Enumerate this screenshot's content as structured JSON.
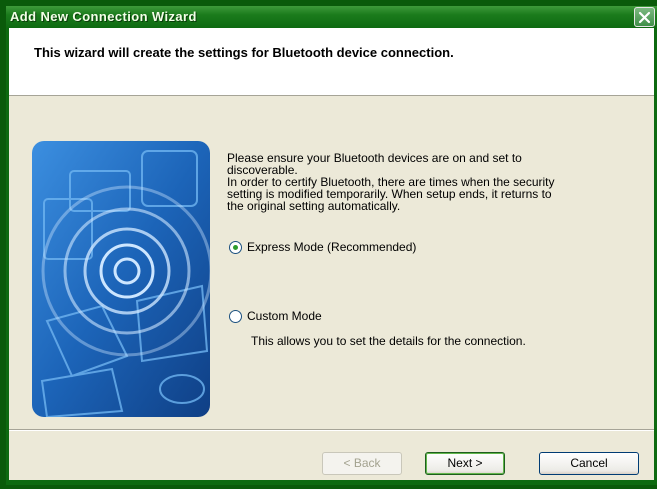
{
  "window": {
    "title": "Add New Connection Wizard"
  },
  "header": {
    "text": "This wizard will create the settings for Bluetooth device connection."
  },
  "body": {
    "description_lines": [
      "Please ensure your Bluetooth devices are on and set to",
      "discoverable.",
      "In order to certify Bluetooth, there are times when the security",
      "setting is modified temporarily. When setup ends, it returns to",
      "the original setting automatically."
    ],
    "modes": [
      {
        "label": "Express Mode (Recommended)",
        "selected": true
      },
      {
        "label": "Custom Mode",
        "selected": false,
        "description": "This allows you to set the details for the connection."
      }
    ]
  },
  "buttons": {
    "back": "< Back",
    "next": "Next >",
    "cancel": "Cancel"
  },
  "colors": {
    "titlebar": "#1b7b1c",
    "panel_bg": "#ece9d8",
    "illustration_blue": "#1d6fc4"
  }
}
